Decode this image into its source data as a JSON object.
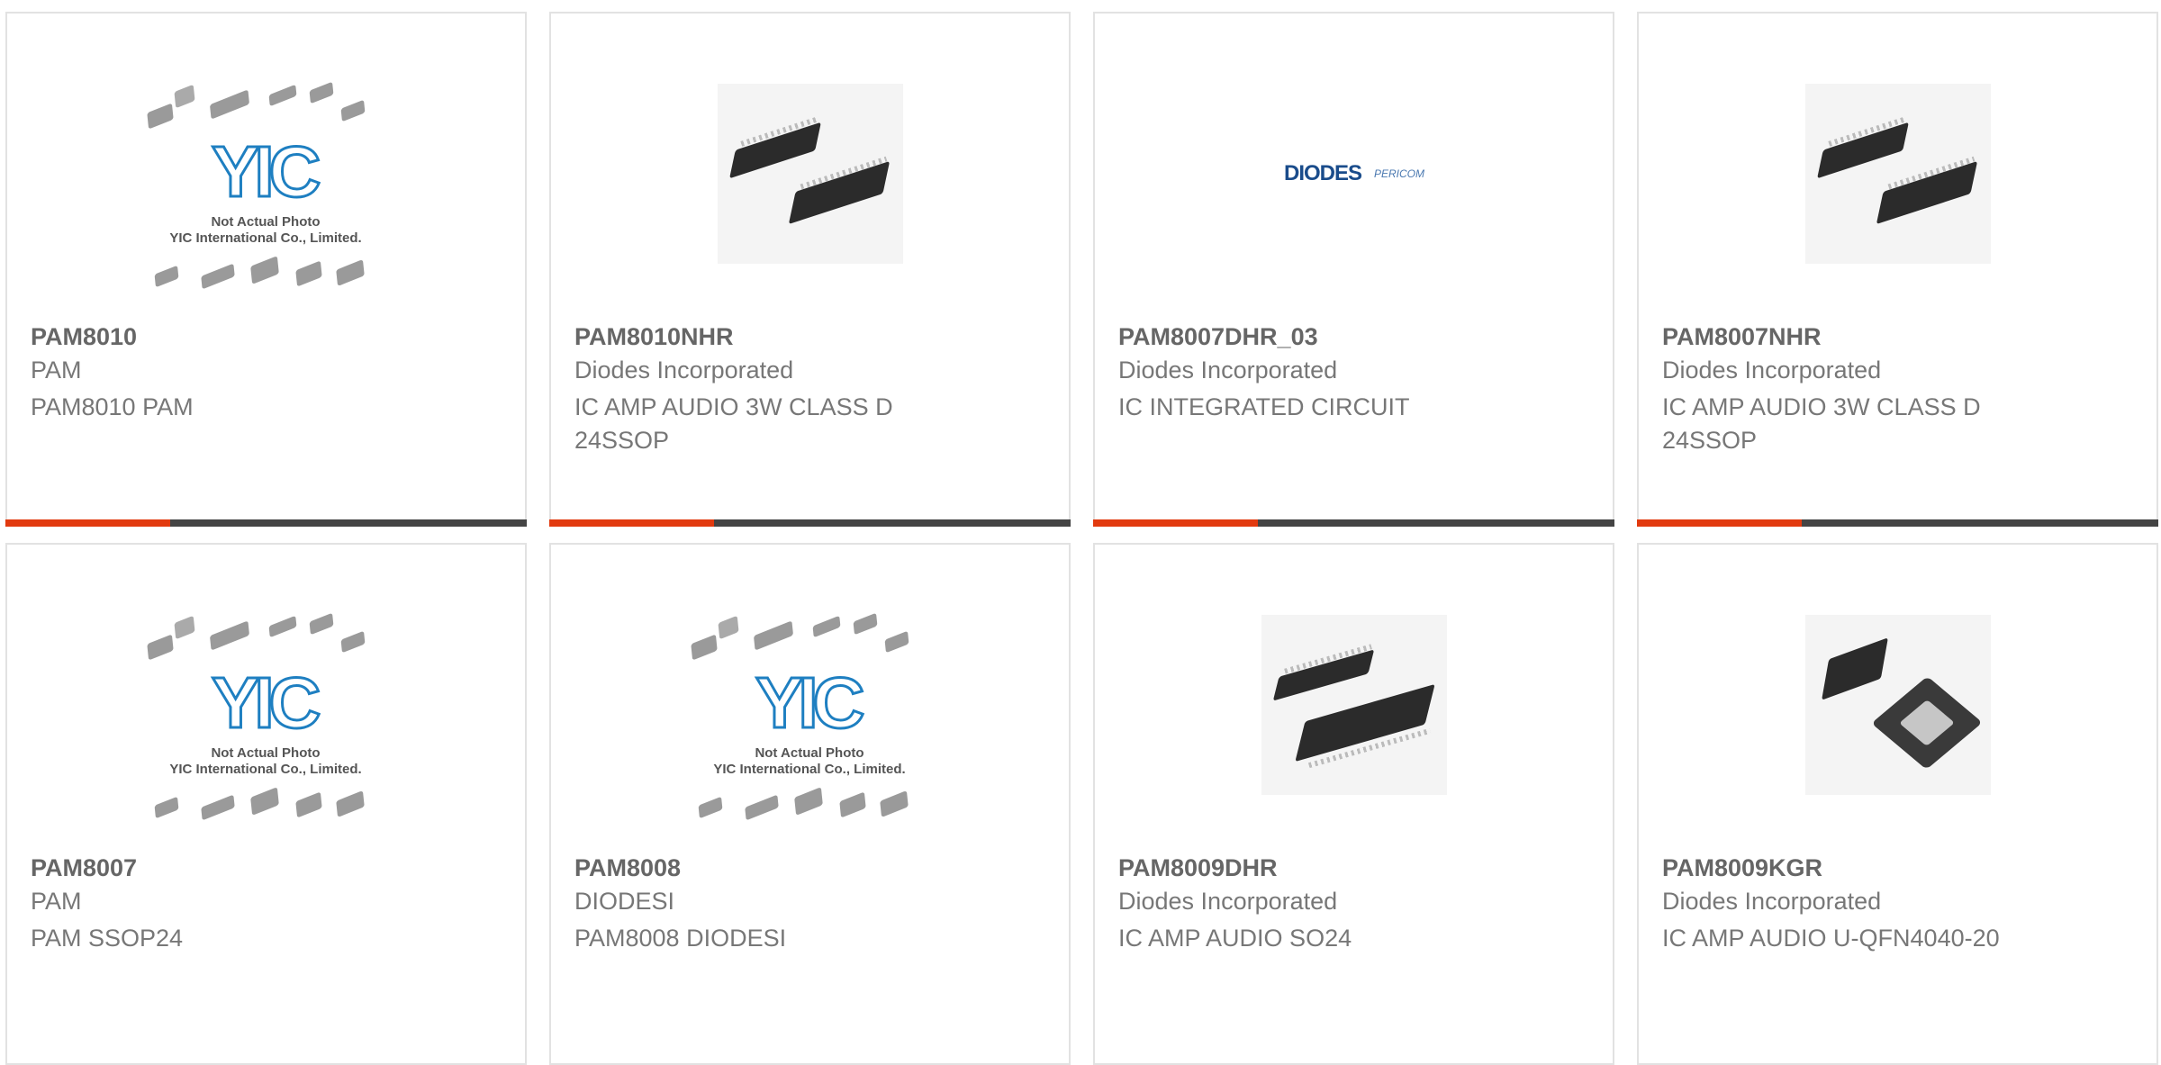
{
  "placeholder": {
    "brand": "YIC",
    "line1": "Not Actual Photo",
    "line2": "YIC International Co., Limited."
  },
  "diodes_logo": {
    "brand": "DIODES",
    "sub": "PERICOM"
  },
  "products": [
    {
      "part": "PAM8010",
      "maker": "PAM",
      "desc": "PAM8010 PAM",
      "image": "placeholder"
    },
    {
      "part": "PAM8010NHR",
      "maker": "Diodes Incorporated",
      "desc": "IC AMP AUDIO 3W CLASS D 24SSOP",
      "image": "ssop-photo"
    },
    {
      "part": "PAM8007DHR_03",
      "maker": "Diodes Incorporated",
      "desc": "IC INTEGRATED CIRCUIT",
      "image": "diodes-logo"
    },
    {
      "part": "PAM8007NHR",
      "maker": "Diodes Incorporated",
      "desc": "IC AMP AUDIO 3W CLASS D 24SSOP",
      "image": "ssop-photo"
    },
    {
      "part": "PAM8007",
      "maker": "PAM",
      "desc": "PAM SSOP24",
      "image": "placeholder"
    },
    {
      "part": "PAM8008",
      "maker": "DIODESI",
      "desc": "PAM8008 DIODESI",
      "image": "placeholder"
    },
    {
      "part": "PAM8009DHR",
      "maker": "Diodes Incorporated",
      "desc": "IC AMP AUDIO SO24",
      "image": "so24-photo"
    },
    {
      "part": "PAM8009KGR",
      "maker": "Diodes Incorporated",
      "desc": "IC AMP AUDIO U-QFN4040-20",
      "image": "qfn-photo"
    }
  ],
  "colors": {
    "accent": "#e23a0f",
    "bar": "#444444",
    "title": "#666666",
    "text": "#777777"
  }
}
